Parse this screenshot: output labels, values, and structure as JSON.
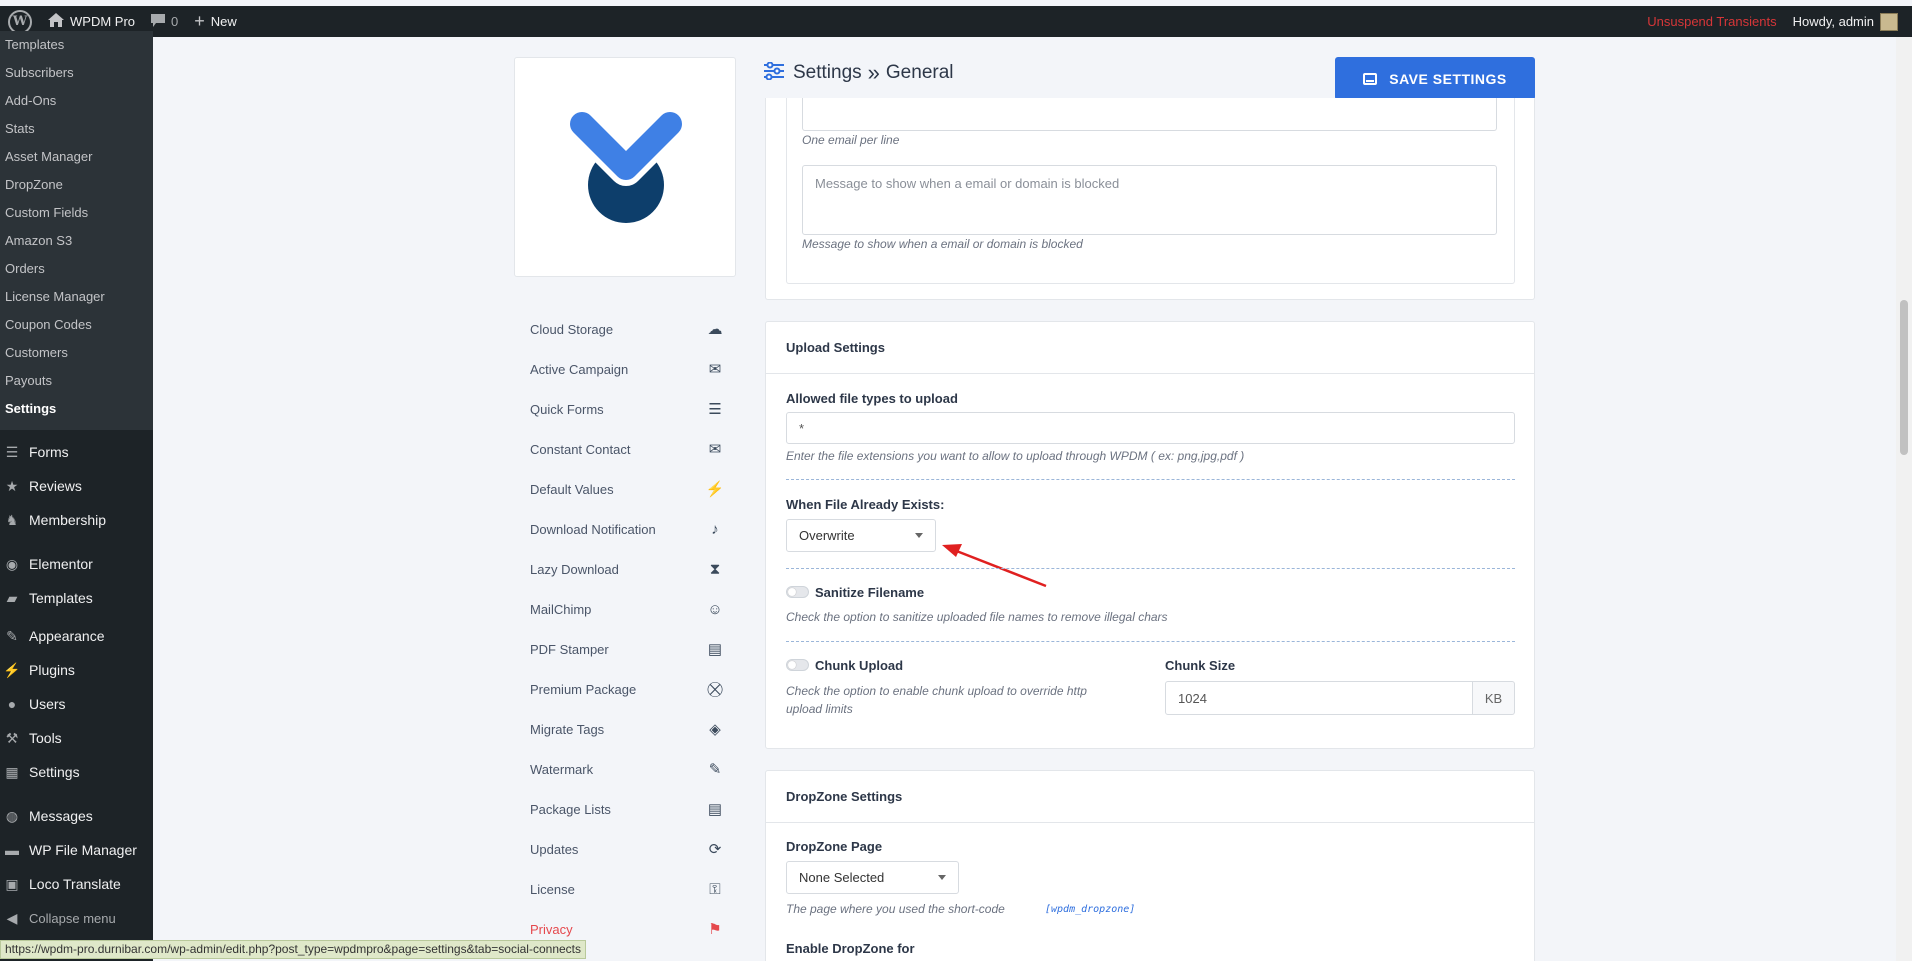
{
  "admin_bar": {
    "site_name": "WPDM Pro",
    "comments_count": "0",
    "new_label": "New",
    "unsuspend_label": "Unsuspend Transients",
    "howdy_label": "Howdy, admin"
  },
  "sidebar": {
    "submenu": [
      "Templates",
      "Subscribers",
      "Add-Ons",
      "Stats",
      "Asset Manager",
      "DropZone",
      "Custom Fields",
      "Amazon S3",
      "Orders",
      "License Manager",
      "Coupon Codes",
      "Customers",
      "Payouts",
      "Settings"
    ],
    "current_submenu": "Settings",
    "menu": [
      {
        "label": "Forms",
        "icon": "forms-icon"
      },
      {
        "label": "Reviews",
        "icon": "star-icon"
      },
      {
        "label": "Membership",
        "icon": "membership-icon"
      },
      {
        "label": "Elementor",
        "icon": "elementor-icon"
      },
      {
        "label": "Templates",
        "icon": "folder-icon"
      },
      {
        "label": "Appearance",
        "icon": "brush-icon"
      },
      {
        "label": "Plugins",
        "icon": "plug-icon"
      },
      {
        "label": "Users",
        "icon": "user-icon"
      },
      {
        "label": "Tools",
        "icon": "wrench-icon"
      },
      {
        "label": "Settings",
        "icon": "settings-icon"
      },
      {
        "label": "Messages",
        "icon": "messages-icon"
      },
      {
        "label": "WP File Manager",
        "icon": "file-manager-icon"
      },
      {
        "label": "Loco Translate",
        "icon": "translate-icon"
      },
      {
        "label": "Collapse menu",
        "icon": "collapse-icon"
      }
    ]
  },
  "status_url": "https://wpdm-pro.durnibar.com/wp-admin/edit.php?post_type=wpdmpro&page=settings&tab=social-connects",
  "header": {
    "title": "Settings",
    "separator": "»",
    "subtitle": "General",
    "save_label": "SAVE SETTINGS"
  },
  "settings_nav": [
    {
      "label": "Cloud Storage",
      "icon": "cloud-upload-icon"
    },
    {
      "label": "Active Campaign",
      "icon": "envelope-icon"
    },
    {
      "label": "Quick Forms",
      "icon": "list-icon"
    },
    {
      "label": "Constant Contact",
      "icon": "envelope-icon"
    },
    {
      "label": "Default Values",
      "icon": "bolt-icon"
    },
    {
      "label": "Download Notification",
      "icon": "bell-icon"
    },
    {
      "label": "Lazy Download",
      "icon": "hourglass-icon"
    },
    {
      "label": "MailChimp",
      "icon": "mailchimp-icon"
    },
    {
      "label": "PDF Stamper",
      "icon": "pdf-file-icon"
    },
    {
      "label": "Premium Package",
      "icon": "basket-icon"
    },
    {
      "label": "Migrate Tags",
      "icon": "tags-icon"
    },
    {
      "label": "Watermark",
      "icon": "pencil-icon"
    },
    {
      "label": "Package Lists",
      "icon": "list-alt-icon"
    },
    {
      "label": "Updates",
      "icon": "sync-icon"
    },
    {
      "label": "License",
      "icon": "key-icon"
    },
    {
      "label": "Privacy",
      "icon": "user-shield-icon"
    }
  ],
  "email_block": {
    "emails_hint": "One email per line",
    "message_placeholder": "Message to show when a email or domain is blocked",
    "message_hint": "Message to show when a email or domain is blocked"
  },
  "upload_settings": {
    "title": "Upload Settings",
    "allowed_label": "Allowed file types to upload",
    "allowed_value": "*",
    "allowed_hint": "Enter the file extensions you want to allow to upload through WPDM ( ex: png,jpg,pdf )",
    "exists_label": "When File Already Exists:",
    "exists_value": "Overwrite",
    "sanitize_label": "Sanitize Filename",
    "sanitize_hint": "Check the option to sanitize uploaded file names to remove illegal chars",
    "chunk_label": "Chunk Upload",
    "chunk_hint_1": "Check the option to enable chunk upload to override http",
    "chunk_hint_2": "upload limits",
    "chunk_size_label": "Chunk Size",
    "chunk_size_value": "1024",
    "chunk_size_unit": "KB"
  },
  "dropzone_settings": {
    "title": "DropZone Settings",
    "page_label": "DropZone Page",
    "page_value": "None Selected",
    "page_hint": "The page where you used the short-code",
    "shortcode": "[wpdm_dropzone]",
    "enable_label": "Enable DropZone for"
  },
  "colors": {
    "accent": "#2f6fde",
    "admin_bar": "#1d2327",
    "warning": "#d63638",
    "arrow": "#e02020"
  }
}
